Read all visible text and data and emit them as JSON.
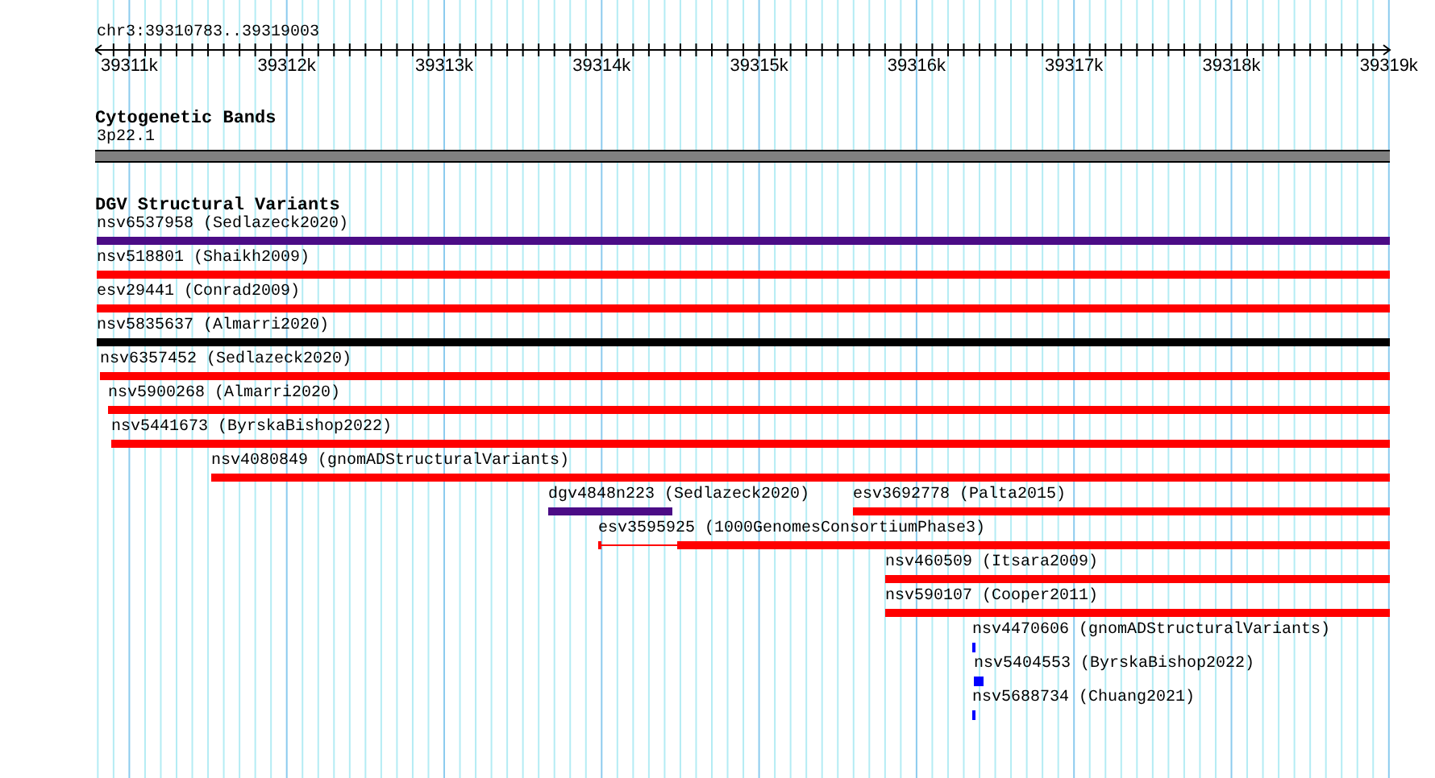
{
  "ruler": {
    "location": "chr3:39310783..39319003",
    "ticks": [
      "39311k",
      "39312k",
      "39313k",
      "39314k",
      "39315k",
      "39316k",
      "39317k",
      "39318k",
      "39319k"
    ]
  },
  "tracks": [
    {
      "title": "Cytogenetic Bands",
      "features": [
        {
          "label": "3p22.1",
          "color": "#808080",
          "kind": "band"
        }
      ]
    },
    {
      "title": "DGV Structural Variants",
      "features": [
        {
          "label": "nsv6537958 (Sedlazeck2020)",
          "color": "#4b0c86",
          "kind": "bar"
        },
        {
          "label": "nsv518801 (Shaikh2009)",
          "color": "#ff0000",
          "kind": "bar"
        },
        {
          "label": "esv29441 (Conrad2009)",
          "color": "#ff0000",
          "kind": "bar"
        },
        {
          "label": "nsv5835637 (Almarri2020)",
          "color": "#000000",
          "kind": "bar"
        },
        {
          "label": "nsv6357452 (Sedlazeck2020)",
          "color": "#ff0000",
          "kind": "bar"
        },
        {
          "label": "nsv5900268 (Almarri2020)",
          "color": "#ff0000",
          "kind": "bar"
        },
        {
          "label": "nsv5441673 (ByrskaBishop2022)",
          "color": "#ff0000",
          "kind": "bar"
        },
        {
          "label": "nsv4080849 (gnomADStructuralVariants)",
          "color": "#ff0000",
          "kind": "bar"
        },
        {
          "label": "dgv4848n223 (Sedlazeck2020)",
          "color": "#4b0c86",
          "kind": "bar"
        },
        {
          "label": "esv3692778 (Palta2015)",
          "color": "#ff0000",
          "kind": "bar"
        },
        {
          "label": "esv3595925 (1000GenomesConsortiumPhase3)",
          "color": "#ff0000",
          "kind": "split"
        },
        {
          "label": "nsv460509 (Itsara2009)",
          "color": "#ff0000",
          "kind": "bar"
        },
        {
          "label": "nsv590107 (Cooper2011)",
          "color": "#ff0000",
          "kind": "bar"
        },
        {
          "label": "nsv4470606 (gnomADStructuralVariants)",
          "color": "#0000ff",
          "kind": "bar"
        },
        {
          "label": "nsv5404553 (ByrskaBishop2022)",
          "color": "#0000ff",
          "kind": "bar"
        },
        {
          "label": "nsv5688734 (Chuang2021)",
          "color": "#0000ff",
          "kind": "bar"
        }
      ]
    }
  ]
}
